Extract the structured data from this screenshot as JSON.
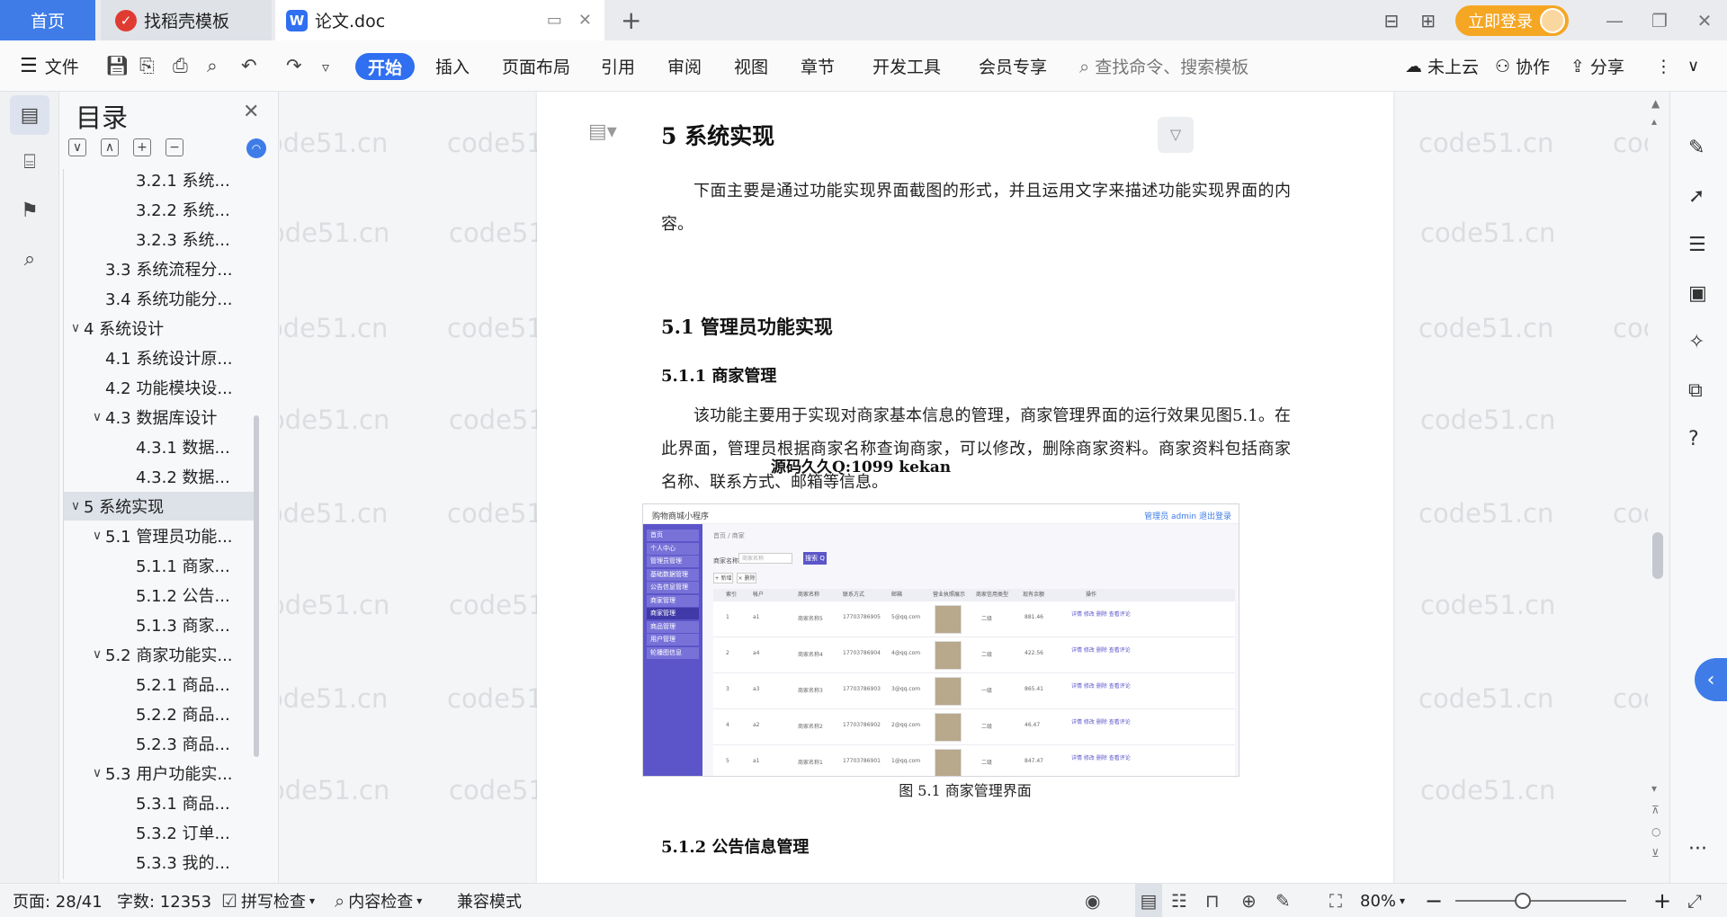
{
  "titlebar": {
    "home_tab": "首页",
    "tabs": [
      {
        "label": "找稻壳模板",
        "icon": "daoke-icon"
      },
      {
        "label": "论文.doc",
        "icon": "wps-writer-icon"
      }
    ],
    "add_tab": "+",
    "login_label": "立即登录"
  },
  "ribbon": {
    "file_label": "文件",
    "menu": [
      "开始",
      "插入",
      "页面布局",
      "引用",
      "审阅",
      "视图",
      "章节",
      "开发工具",
      "会员专享"
    ],
    "active_menu": "开始",
    "search_placeholder": "查找命令、搜索模板",
    "right": [
      "未上云",
      "协作",
      "分享"
    ]
  },
  "toc": {
    "title": "目录",
    "items": [
      {
        "level": 3,
        "text": "3.2.1 系统...",
        "caret": ""
      },
      {
        "level": 3,
        "text": "3.2.2 系统...",
        "caret": ""
      },
      {
        "level": 3,
        "text": "3.2.3 系统...",
        "caret": ""
      },
      {
        "level": 2,
        "text": "3.3 系统流程分...",
        "caret": ""
      },
      {
        "level": 2,
        "text": "3.4 系统功能分...",
        "caret": ""
      },
      {
        "level": 1,
        "text": "4 系统设计",
        "caret": "∨"
      },
      {
        "level": 2,
        "text": "4.1 系统设计原...",
        "caret": ""
      },
      {
        "level": 2,
        "text": "4.2 功能模块设...",
        "caret": ""
      },
      {
        "level": 2,
        "text": "4.3 数据库设计",
        "caret": "∨"
      },
      {
        "level": 3,
        "text": "4.3.1 数据...",
        "caret": ""
      },
      {
        "level": 3,
        "text": "4.3.2 数据...",
        "caret": ""
      },
      {
        "level": 1,
        "text": "5 系统实现",
        "caret": "∨",
        "selected": true
      },
      {
        "level": 2,
        "text": "5.1 管理员功能...",
        "caret": "∨"
      },
      {
        "level": 3,
        "text": "5.1.1 商家...",
        "caret": ""
      },
      {
        "level": 3,
        "text": "5.1.2 公告...",
        "caret": ""
      },
      {
        "level": 3,
        "text": "5.1.3 商家...",
        "caret": ""
      },
      {
        "level": 2,
        "text": "5.2 商家功能实...",
        "caret": "∨"
      },
      {
        "level": 3,
        "text": "5.2.1 商品...",
        "caret": ""
      },
      {
        "level": 3,
        "text": "5.2.2 商品...",
        "caret": ""
      },
      {
        "level": 3,
        "text": "5.2.3 商品...",
        "caret": ""
      },
      {
        "level": 2,
        "text": "5.3 用户功能实...",
        "caret": "∨"
      },
      {
        "level": 3,
        "text": "5.3.1 商品...",
        "caret": ""
      },
      {
        "level": 3,
        "text": "5.3.2 订单...",
        "caret": ""
      },
      {
        "level": 3,
        "text": "5.3.3 我的...",
        "caret": ""
      }
    ]
  },
  "document": {
    "h1": "5  系统实现",
    "intro": "下面主要是通过功能实现界面截图的形式，并且运用文字来描述功能实现界面的内容。",
    "h2": "5.1  管理员功能实现",
    "h3a": "5.1.1  商家管理",
    "para": "该功能主要用于实现对商家基本信息的管理，商家管理界面的运行效果见图5.1。在此界面，管理员根据商家名称查询商家，可以修改，删除商家资料。商家资料包括商家名称、联系方式、邮箱等信息。",
    "overlay": "源码久久Q:1099 kekan",
    "caption": "图 5.1  商家管理界面",
    "h3b": "5.1.2  公告信息管理"
  },
  "figure": {
    "app_title": "购物商城小程序",
    "top_right": "管理员 admin  退出登录",
    "menus": [
      "首页",
      "个人中心",
      "管理员管理",
      "基础数据管理",
      "公告信息管理",
      "商家管理",
      "商家管理",
      "商品管理",
      "用户管理",
      "轮播图信息"
    ],
    "breadcrumb": "首页 / 商家",
    "search_label": "商家名称",
    "search_placeholder": "商家名称",
    "search_button": "搜索 Q",
    "buttons": [
      "+ 新增",
      "× 删除"
    ],
    "headers": [
      "索引",
      "帐户",
      "商家名称",
      "联系方式",
      "邮箱",
      "营业执照展示",
      "商家信用类型",
      "现有余额",
      "操作"
    ],
    "rows": [
      [
        "1",
        "a1",
        "商家名称5",
        "17703786905",
        "5@qq.com",
        "二级",
        "881.46"
      ],
      [
        "2",
        "a4",
        "商家名称4",
        "17703786904",
        "4@qq.com",
        "二级",
        "422.56"
      ],
      [
        "3",
        "a3",
        "商家名称3",
        "17703786903",
        "3@qq.com",
        "一级",
        "865.41"
      ],
      [
        "4",
        "a2",
        "商家名称2",
        "17703786902",
        "2@qq.com",
        "二级",
        "46.47"
      ],
      [
        "5",
        "a1",
        "商家名称1",
        "17703786901",
        "1@qq.com",
        "二级",
        "847.47"
      ]
    ],
    "ops": "详情 修改 删除 查看评论"
  },
  "watermark": "code51.cn",
  "statusbar": {
    "page": "页面: 28/41",
    "words": "字数: 12353",
    "spell": "拼写检查",
    "content_check": "内容检查",
    "compat": "兼容模式",
    "zoom": "80%"
  }
}
